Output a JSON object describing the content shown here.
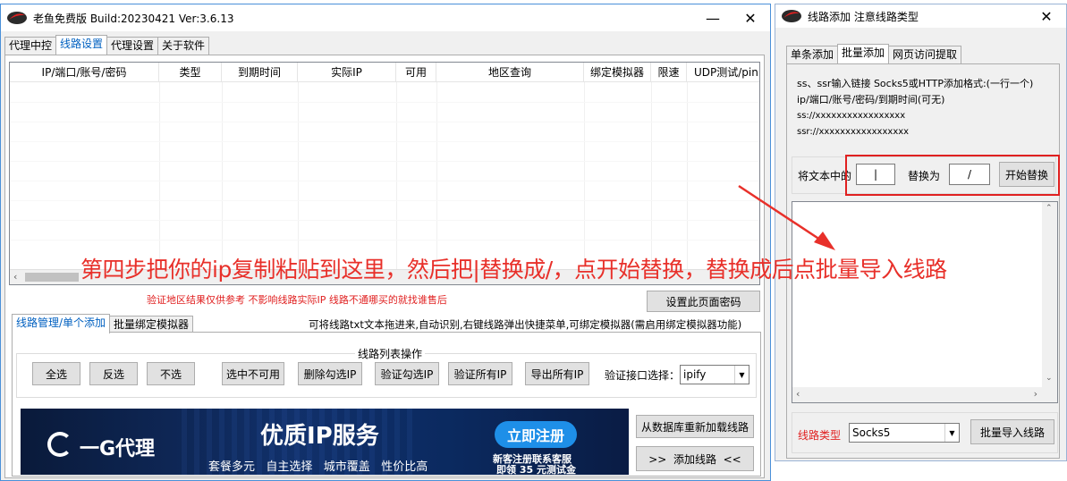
{
  "main_window": {
    "title": "老鱼免费版 Build:20230421 Ver:3.6.13",
    "tabs": [
      "代理中控",
      "线路设置",
      "代理设置",
      "关于软件"
    ],
    "active_tab": 1,
    "table_headers": [
      "IP/端口/账号/密码",
      "类型",
      "到期时间",
      "实际IP",
      "可用",
      "地区查询",
      "绑定模拟器",
      "限速",
      "UDP测试/pin"
    ],
    "notice": "验证地区结果仅供参考 不影响线路实际IP 线路不通哪买的就找谁售后",
    "set_password_button": "设置此页面密码",
    "sub_tabs": [
      "线路管理/单个添加",
      "批量绑定模拟器"
    ],
    "hint": "可将线路txt文本拖进来,自动识别,右键线路弹出快捷菜单,可绑定模拟器(需启用绑定模拟器功能)",
    "group_title": "线路列表操作",
    "buttons": [
      "全选",
      "反选",
      "不选",
      "选中不可用",
      "删除勾选IP",
      "验证勾选IP",
      "验证所有IP",
      "导出所有IP"
    ],
    "api_label": "验证接口选择：",
    "api_value": "ipify",
    "reload_button": "从数据库重新加载线路",
    "add_button": ">>  添加线路  <<"
  },
  "banner": {
    "brand": "一G代理",
    "headline": "优质IP服务",
    "features": "套餐多元   自主选择   城市覆盖   性价比高",
    "cta": "立即注册",
    "promo_line1": "新客注册联系客服",
    "promo_line2": "即领 35 元测试金"
  },
  "annotation": "第四步把你的ip复制粘贴到这里，然后把|替换成/，点开始替换，替换成后点批量导入线路",
  "dialog": {
    "title": "线路添加 注意线路类型",
    "tabs": [
      "单条添加",
      "批量添加",
      "网页访问提取"
    ],
    "active_tab": 1,
    "info_lines": [
      "ss、ssr输入链接 Socks5或HTTP添加格式:(一行一个)",
      "ip/端口/账号/密码/到期时间(可无)",
      "ss://xxxxxxxxxxxxxxxxx",
      "ssr://xxxxxxxxxxxxxxxxx"
    ],
    "replace_label": "将文本中的",
    "find_value": "|",
    "replace_with_label": "替换为",
    "replace_value": "/",
    "start_replace_button": "开始替换",
    "type_label": "线路类型",
    "type_value": "Socks5",
    "import_button": "批量导入线路"
  },
  "colors": {
    "accent_blue": "#0078d7",
    "annotation_red": "#e8302a",
    "highlight_box": "#e02020",
    "cta_blue": "#1e8fe8"
  }
}
